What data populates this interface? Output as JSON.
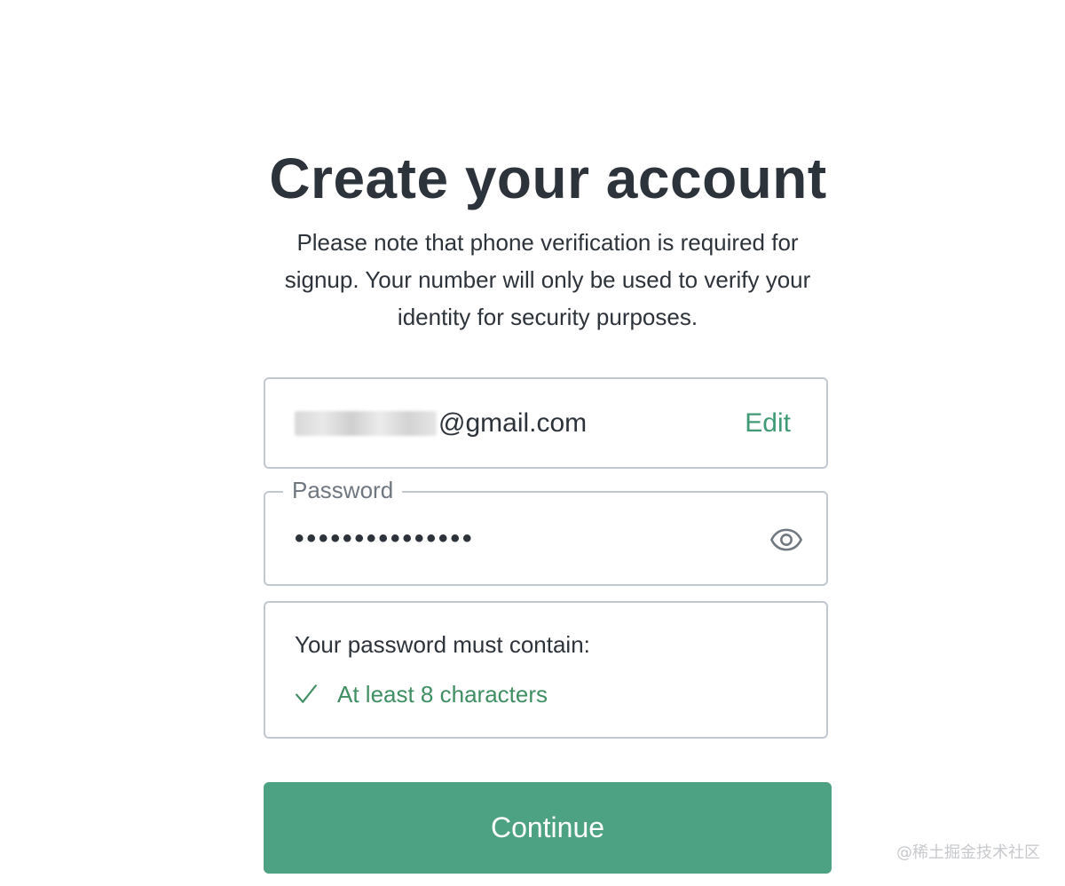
{
  "heading": {
    "title": "Create your account",
    "subtitle": "Please note that phone verification is required for signup. Your number will only be used to verify your identity for security purposes."
  },
  "email": {
    "value_suffix": "@gmail.com",
    "edit_label": "Edit"
  },
  "password": {
    "label": "Password",
    "value": "•••••••••••••••",
    "toggle_icon": "eye-icon"
  },
  "requirements": {
    "title": "Your password must contain:",
    "items": [
      {
        "label": "At least 8 characters",
        "met": true,
        "icon": "check-icon"
      }
    ]
  },
  "actions": {
    "continue_label": "Continue"
  },
  "watermark": {
    "text": "@稀土掘金技术社区"
  },
  "colors": {
    "accent": "#4da283",
    "link": "#3f9a75",
    "success": "#3f8f62",
    "text": "#2d333a",
    "border": "#c2c8d0"
  }
}
